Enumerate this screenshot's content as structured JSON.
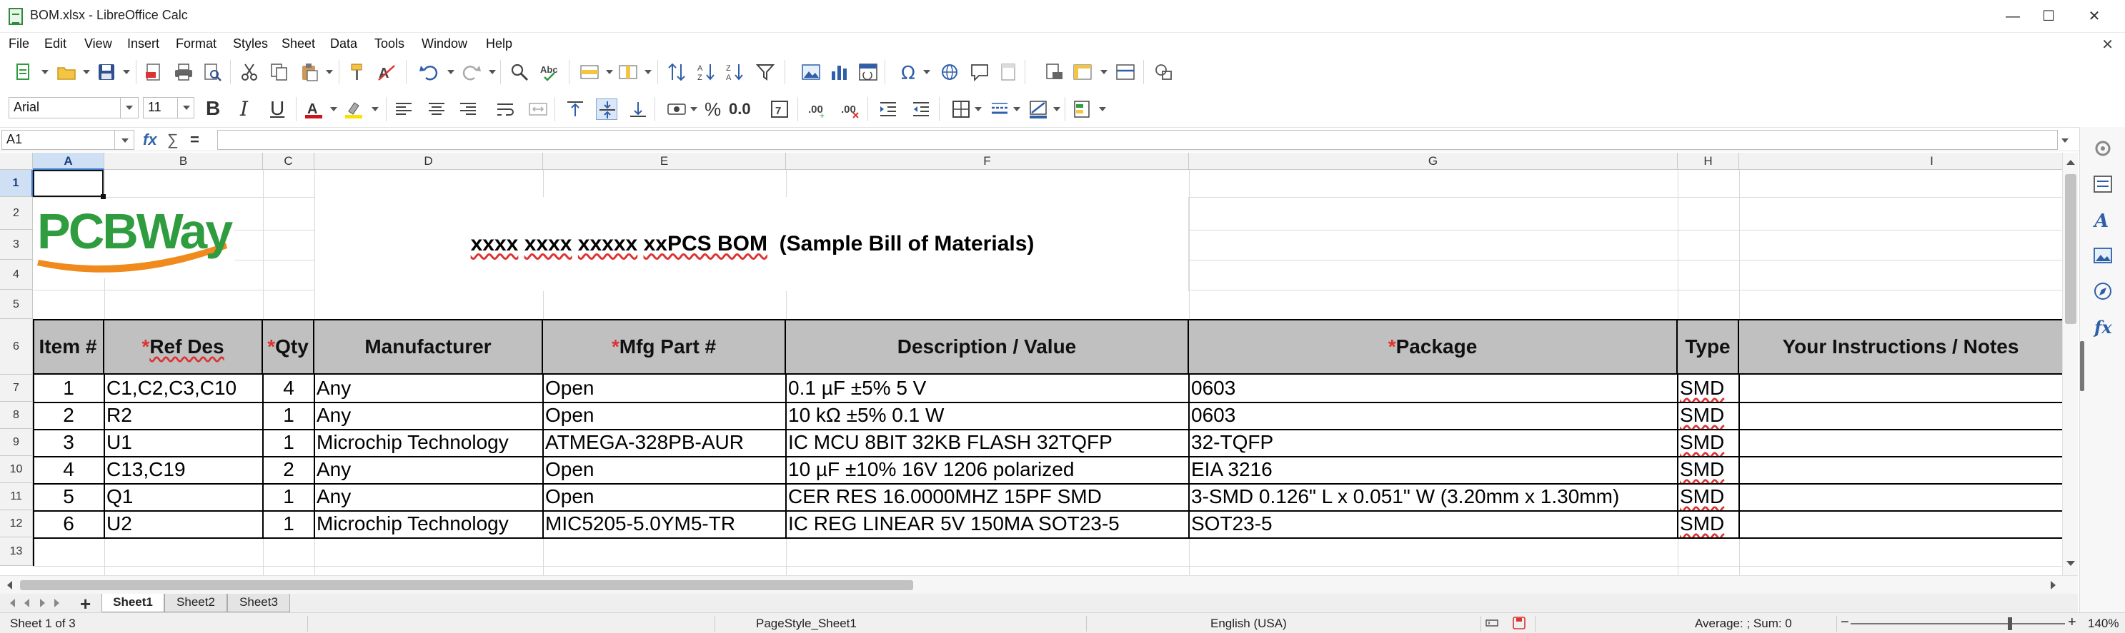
{
  "window": {
    "title": "BOM.xlsx - LibreOffice Calc",
    "minimize": "—",
    "maximize": "☐",
    "close": "✕"
  },
  "menu": [
    "File",
    "Edit",
    "View",
    "Insert",
    "Format",
    "Styles",
    "Sheet",
    "Data",
    "Tools",
    "Window",
    "Help"
  ],
  "doc_close": "✕",
  "font_toolbar": {
    "font_name": "Arial",
    "font_size": "11",
    "bold": "B",
    "italic": "I",
    "underline": "U",
    "percent": "%",
    "decimal": "0.0"
  },
  "formula_bar": {
    "name_box": "A1",
    "fx": "fx",
    "sum": "∑",
    "equals": "=",
    "content": ""
  },
  "columns": [
    "A",
    "B",
    "C",
    "D",
    "E",
    "F",
    "G",
    "H",
    "I"
  ],
  "rows": [
    "1",
    "2",
    "3",
    "4",
    "5",
    "6",
    "7",
    "8",
    "9",
    "10",
    "11",
    "12",
    "13"
  ],
  "selected_cell": "A1",
  "logo_text": "PCBWay",
  "sheet_title": {
    "part1": "xxxx",
    "part2": "xxxx",
    "part3": "xxxxx",
    "part4": "xxPCS BOM",
    "part5": "(Sample Bill of Materials)"
  },
  "table": {
    "headers": [
      {
        "required": "",
        "label": "Item #"
      },
      {
        "required": "*",
        "label": "Ref Des"
      },
      {
        "required": "*",
        "label": "Qty"
      },
      {
        "required": "",
        "label": "Manufacturer"
      },
      {
        "required": "*",
        "label": "Mfg Part #"
      },
      {
        "required": "",
        "label": "Description / Value"
      },
      {
        "required": "*",
        "label": "Package"
      },
      {
        "required": "",
        "label": "Type"
      },
      {
        "required": "",
        "label": "Your Instructions / Notes"
      }
    ],
    "rows": [
      [
        "1",
        "C1,C2,C3,C10",
        "4",
        "Any",
        "Open",
        "0.1 µF ±5% 5 V",
        "0603",
        "SMD",
        ""
      ],
      [
        "2",
        "R2",
        "1",
        "Any",
        "Open",
        "10 kΩ ±5% 0.1 W",
        "0603",
        "SMD",
        ""
      ],
      [
        "3",
        "U1",
        "1",
        "Microchip Technology",
        "ATMEGA-328PB-AUR",
        "IC MCU 8BIT 32KB FLASH 32TQFP",
        "32-TQFP",
        "SMD",
        ""
      ],
      [
        "4",
        "C13,C19",
        "2",
        "Any",
        "Open",
        "10 µF ±10% 16V 1206 polarized",
        "EIA 3216",
        "SMD",
        ""
      ],
      [
        "5",
        "Q1",
        "1",
        "Any",
        "Open",
        "CER RES 16.0000MHZ 15PF SMD",
        "3-SMD 0.126\" L x 0.051\" W (3.20mm x 1.30mm)",
        "SMD",
        ""
      ],
      [
        "6",
        "U2",
        "1",
        "Microchip Technology",
        "MIC5205-5.0YM5-TR",
        "IC REG LINEAR 5V 150MA SOT23-5",
        "SOT23-5",
        "SMD",
        ""
      ]
    ]
  },
  "sheet_tabs": {
    "add": "+",
    "tabs": [
      "Sheet1",
      "Sheet2",
      "Sheet3"
    ],
    "active": "Sheet1"
  },
  "status": {
    "sheet_info": "Sheet 1 of 3",
    "page_style": "PageStyle_Sheet1",
    "language": "English (USA)",
    "summary": "Average: ; Sum: 0",
    "zoom": "140%",
    "zoom_minus": "−",
    "zoom_plus": "+"
  },
  "colors": {
    "accent_green": "#2e9c3f",
    "logo_orange": "#f08a1c",
    "header_gray": "#c0c0c0",
    "required_red": "#e03030",
    "selection_blue": "#cfe0f5"
  }
}
